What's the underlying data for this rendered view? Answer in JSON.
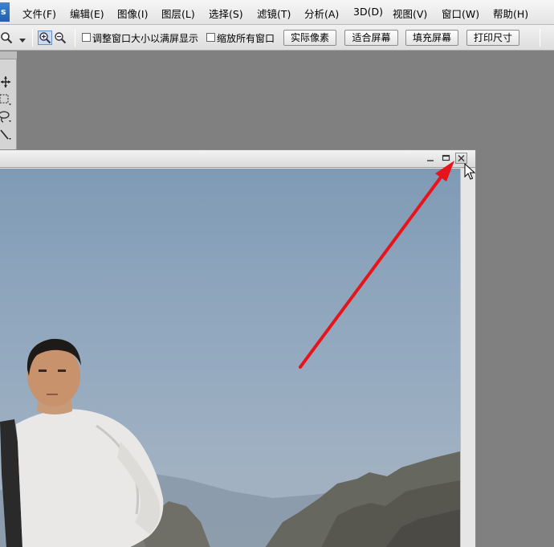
{
  "app": {
    "logo": "s"
  },
  "menu": [
    {
      "label": "文件(F)"
    },
    {
      "label": "编辑(E)"
    },
    {
      "label": "图像(I)"
    },
    {
      "label": "图层(L)"
    },
    {
      "label": "选择(S)"
    },
    {
      "label": "滤镜(T)"
    },
    {
      "label": "分析(A)"
    },
    {
      "label": "3D(D)"
    },
    {
      "label": "视图(V)"
    },
    {
      "label": "窗口(W)"
    },
    {
      "label": "帮助(H)"
    }
  ],
  "options_bar": {
    "resize_windows_label": "调整窗口大小以满屏显示",
    "resize_windows_checked": false,
    "zoom_all_windows_label": "缩放所有窗口",
    "zoom_all_windows_checked": false,
    "actual_pixels_label": "实际像素",
    "fit_screen_label": "适合屏幕",
    "fill_screen_label": "填充屏幕",
    "print_size_label": "打印尺寸",
    "zoom_in_active": true
  },
  "colors": {
    "annotation_arrow": "#e8141b",
    "accent": "#1f5fae"
  },
  "icons": {
    "zoom_tool": "magnifier-icon",
    "zoom_in": "zoom-in-icon",
    "zoom_out": "zoom-out-icon",
    "minimize": "minimize-icon",
    "maximize": "maximize-icon",
    "close": "close-icon",
    "cursor": "mouse-pointer-icon"
  }
}
